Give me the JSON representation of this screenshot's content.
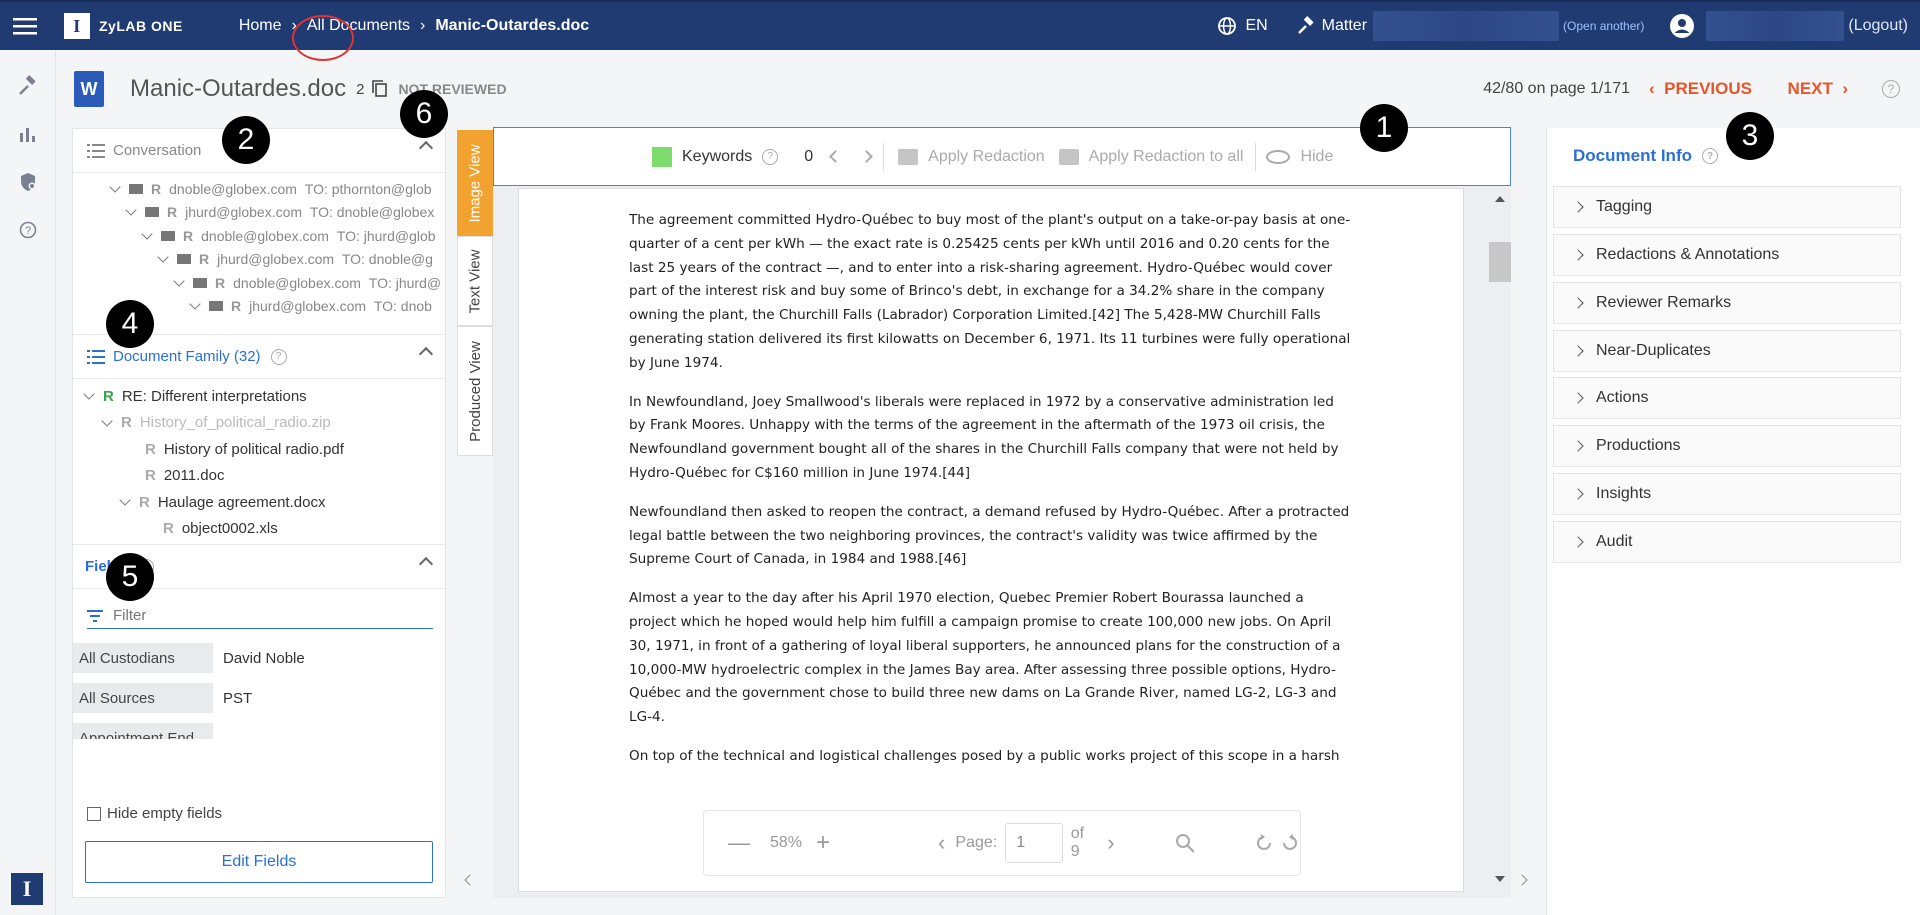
{
  "topbar": {
    "app_name": "ZyLAB ONE",
    "breadcrumbs": [
      "Home",
      "All Documents",
      "Manic-Outardes.doc"
    ],
    "language": "EN",
    "matter_label": "Matter",
    "open_another": "(Open another)",
    "logout": "(Logout)"
  },
  "document": {
    "title": "Manic-Outardes.doc",
    "copies": "2",
    "review_status": "NOT REVIEWED",
    "position": "42/80 on page 1/171",
    "previous": "PREVIOUS",
    "next": "NEXT"
  },
  "markers": [
    "1",
    "2",
    "3",
    "4",
    "5",
    "6"
  ],
  "conversation": {
    "title": "Conversation",
    "rows": [
      {
        "from": "dnoble@globex.com",
        "to": "TO: pthornton@glob"
      },
      {
        "from": "jhurd@globex.com",
        "to": "TO: dnoble@globex"
      },
      {
        "from": "dnoble@globex.com",
        "to": "TO: jhurd@glob"
      },
      {
        "from": "jhurd@globex.com",
        "to": "TO: dnoble@g"
      },
      {
        "from": "dnoble@globex.com",
        "to": "TO: jhurd@"
      },
      {
        "from": "jhurd@globex.com",
        "to": "TO: dnob"
      }
    ]
  },
  "family": {
    "title": "Document Family (32)",
    "items": [
      {
        "label": "RE: Different interpretations",
        "mark": "R"
      },
      {
        "label": "History_of_political_radio.zip",
        "mark": "R"
      },
      {
        "label": "History of political radio.pdf",
        "mark": "R"
      },
      {
        "label": "2011.doc",
        "mark": "R"
      },
      {
        "label": "Haulage agreement.docx",
        "mark": "R"
      },
      {
        "label": "object0002.xls",
        "mark": "R"
      }
    ]
  },
  "fields": {
    "title": "Fields",
    "filter_placeholder": "Filter",
    "rows": [
      {
        "label": "All Custodians",
        "value": "David Noble"
      },
      {
        "label": "All Sources",
        "value": "PST"
      },
      {
        "label": "Appointment End",
        "value": ""
      }
    ],
    "hide_empty": "Hide empty fields",
    "edit_button": "Edit Fields"
  },
  "view_tabs": [
    "Image View",
    "Text View",
    "Produced View"
  ],
  "toolbar": {
    "keywords": "Keywords",
    "count": "0",
    "apply_redaction": "Apply Redaction",
    "apply_redaction_all": "Apply Redaction to all",
    "hide": "Hide"
  },
  "page_text": [
    "The agreement committed Hydro-Québec to buy most of the plant's output on a take-or-pay basis at one-quarter of a cent per kWh — the exact rate is 0.25425 cents per kWh until 2016 and 0.20 cents for the last 25 years of the contract —, and to enter into a risk-sharing agreement. Hydro-Québec would cover part of the interest risk and buy some of Brinco's debt, in exchange for a 34.2% share in the company owning the plant, the Churchill Falls (Labrador) Corporation Limited.[42] The 5,428-MW Churchill Falls generating station delivered its first kilowatts on December 6, 1971. Its 11 turbines were fully operational by June 1974.",
    "In Newfoundland, Joey Smallwood's liberals were replaced in 1972 by a conservative administration led by Frank Moores. Unhappy with the terms of the agreement in the aftermath of the 1973 oil crisis, the Newfoundland government bought all of the shares in the Churchill Falls company that were not held by Hydro-Québec for C$160 million in June 1974.[44]",
    "Newfoundland then asked to reopen the contract, a demand refused by Hydro-Québec. After a protracted legal battle between the two neighboring provinces, the contract's validity was twice affirmed by the Supreme Court of Canada, in 1984 and 1988.[46]",
    "Almost a year to the day after his April 1970 election, Quebec Premier Robert Bourassa launched a project which he hoped would help him fulfill a campaign promise to create 100,000 new jobs. On April 30, 1971, in front of a gathering of loyal liberal supporters, he announced plans for the construction of a 10,000-MW hydroelectric complex in the James Bay area. After assessing three possible options, Hydro-Québec and the government chose to build three new dams on La Grande River, named LG-2, LG-3 and LG-4.",
    "On top of the technical and logistical challenges posed by a public works project of this scope in a harsh"
  ],
  "zoom": {
    "level": "58%",
    "page_label": "Page:",
    "page_value": "1",
    "page_total": "of 9"
  },
  "doc_info": {
    "title": "Document Info",
    "sections": [
      "Tagging",
      "Redactions & Annotations",
      "Reviewer Remarks",
      "Near-Duplicates",
      "Actions",
      "Productions",
      "Insights",
      "Audit"
    ]
  },
  "colors": {
    "topbar": "#203a72",
    "accent": "#2b6fd6",
    "nav": "#e8552b",
    "active_tab": "#f2a22e"
  }
}
